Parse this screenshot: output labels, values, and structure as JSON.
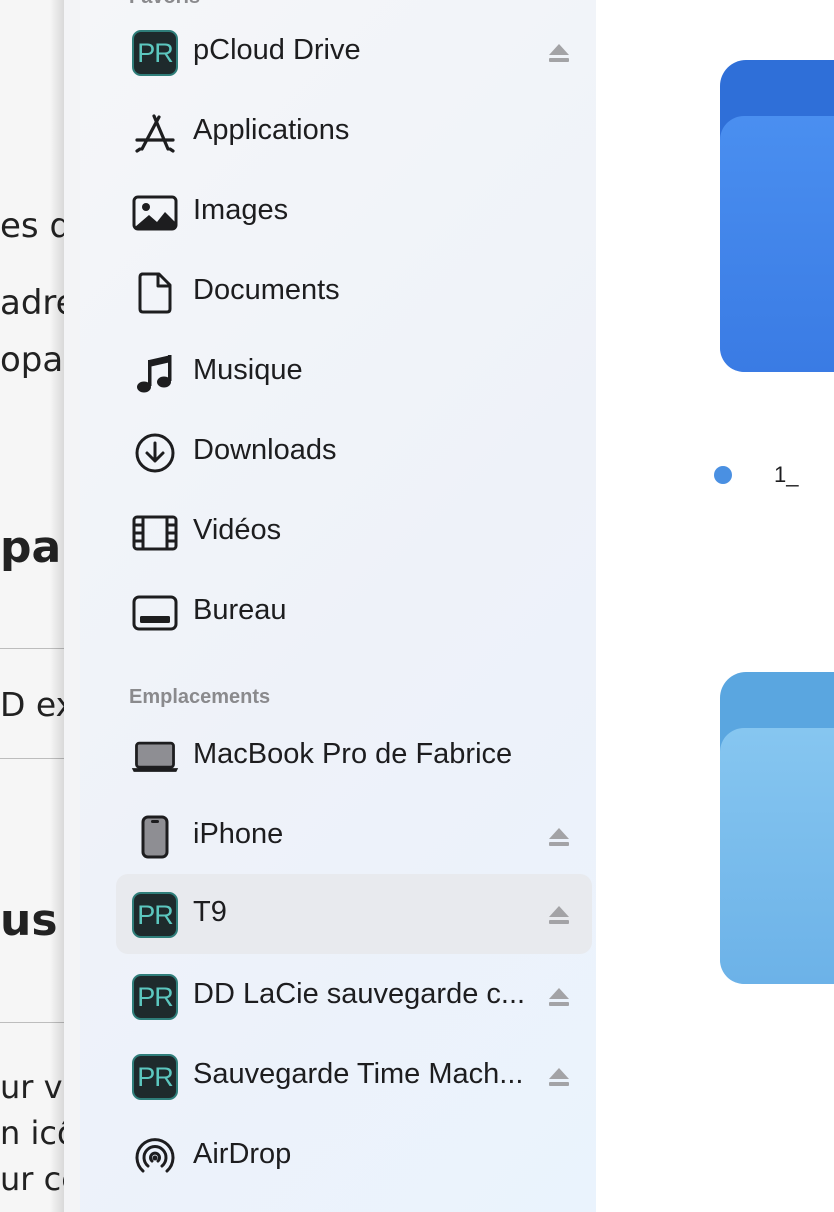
{
  "background_document": {
    "fragments": [
      "es q",
      "adre",
      "opar",
      "par",
      "D ex",
      "us",
      "ur ve",
      "n icô",
      "ur ce"
    ]
  },
  "sidebar": {
    "favorites_label": "Favoris",
    "favorites": [
      {
        "label": "pCloud Drive",
        "icon": "pr-drive-icon",
        "eject": true
      },
      {
        "label": "Applications",
        "icon": "applications-icon",
        "eject": false
      },
      {
        "label": "Images",
        "icon": "images-icon",
        "eject": false
      },
      {
        "label": "Documents",
        "icon": "document-icon",
        "eject": false
      },
      {
        "label": "Musique",
        "icon": "music-note-icon",
        "eject": false
      },
      {
        "label": "Downloads",
        "icon": "download-icon",
        "eject": false
      },
      {
        "label": "Vidéos",
        "icon": "film-icon",
        "eject": false
      },
      {
        "label": "Bureau",
        "icon": "desktop-icon",
        "eject": false
      }
    ],
    "locations_label": "Emplacements",
    "locations": [
      {
        "label": "MacBook Pro de Fabrice",
        "icon": "laptop-icon",
        "eject": false
      },
      {
        "label": "iPhone",
        "icon": "iphone-icon",
        "eject": true
      },
      {
        "label": "T9",
        "icon": "pr-drive-icon",
        "eject": true,
        "selected": true
      },
      {
        "label": "DD LaCie sauvegarde c...",
        "icon": "pr-drive-icon",
        "eject": true
      },
      {
        "label": "Sauvegarde Time Mach...",
        "icon": "pr-drive-icon",
        "eject": true
      },
      {
        "label": "AirDrop",
        "icon": "airdrop-icon",
        "eject": false
      }
    ]
  },
  "content": {
    "folders": [
      {
        "name": "1_",
        "tag_color": "#4a90e2",
        "back_color": "#2f6fd8",
        "front_color": "#3f86ea"
      },
      {
        "name": "",
        "back_color": "#5aa6e0",
        "front_color": "#7ec0ee"
      }
    ]
  },
  "colors": {
    "selection": "#e8eaee",
    "pr_icon_bg": "#1e2a2c",
    "pr_icon_text": "#5cc7bf",
    "label_text": "#1d1d1f",
    "section_text": "#8a8a8d"
  }
}
